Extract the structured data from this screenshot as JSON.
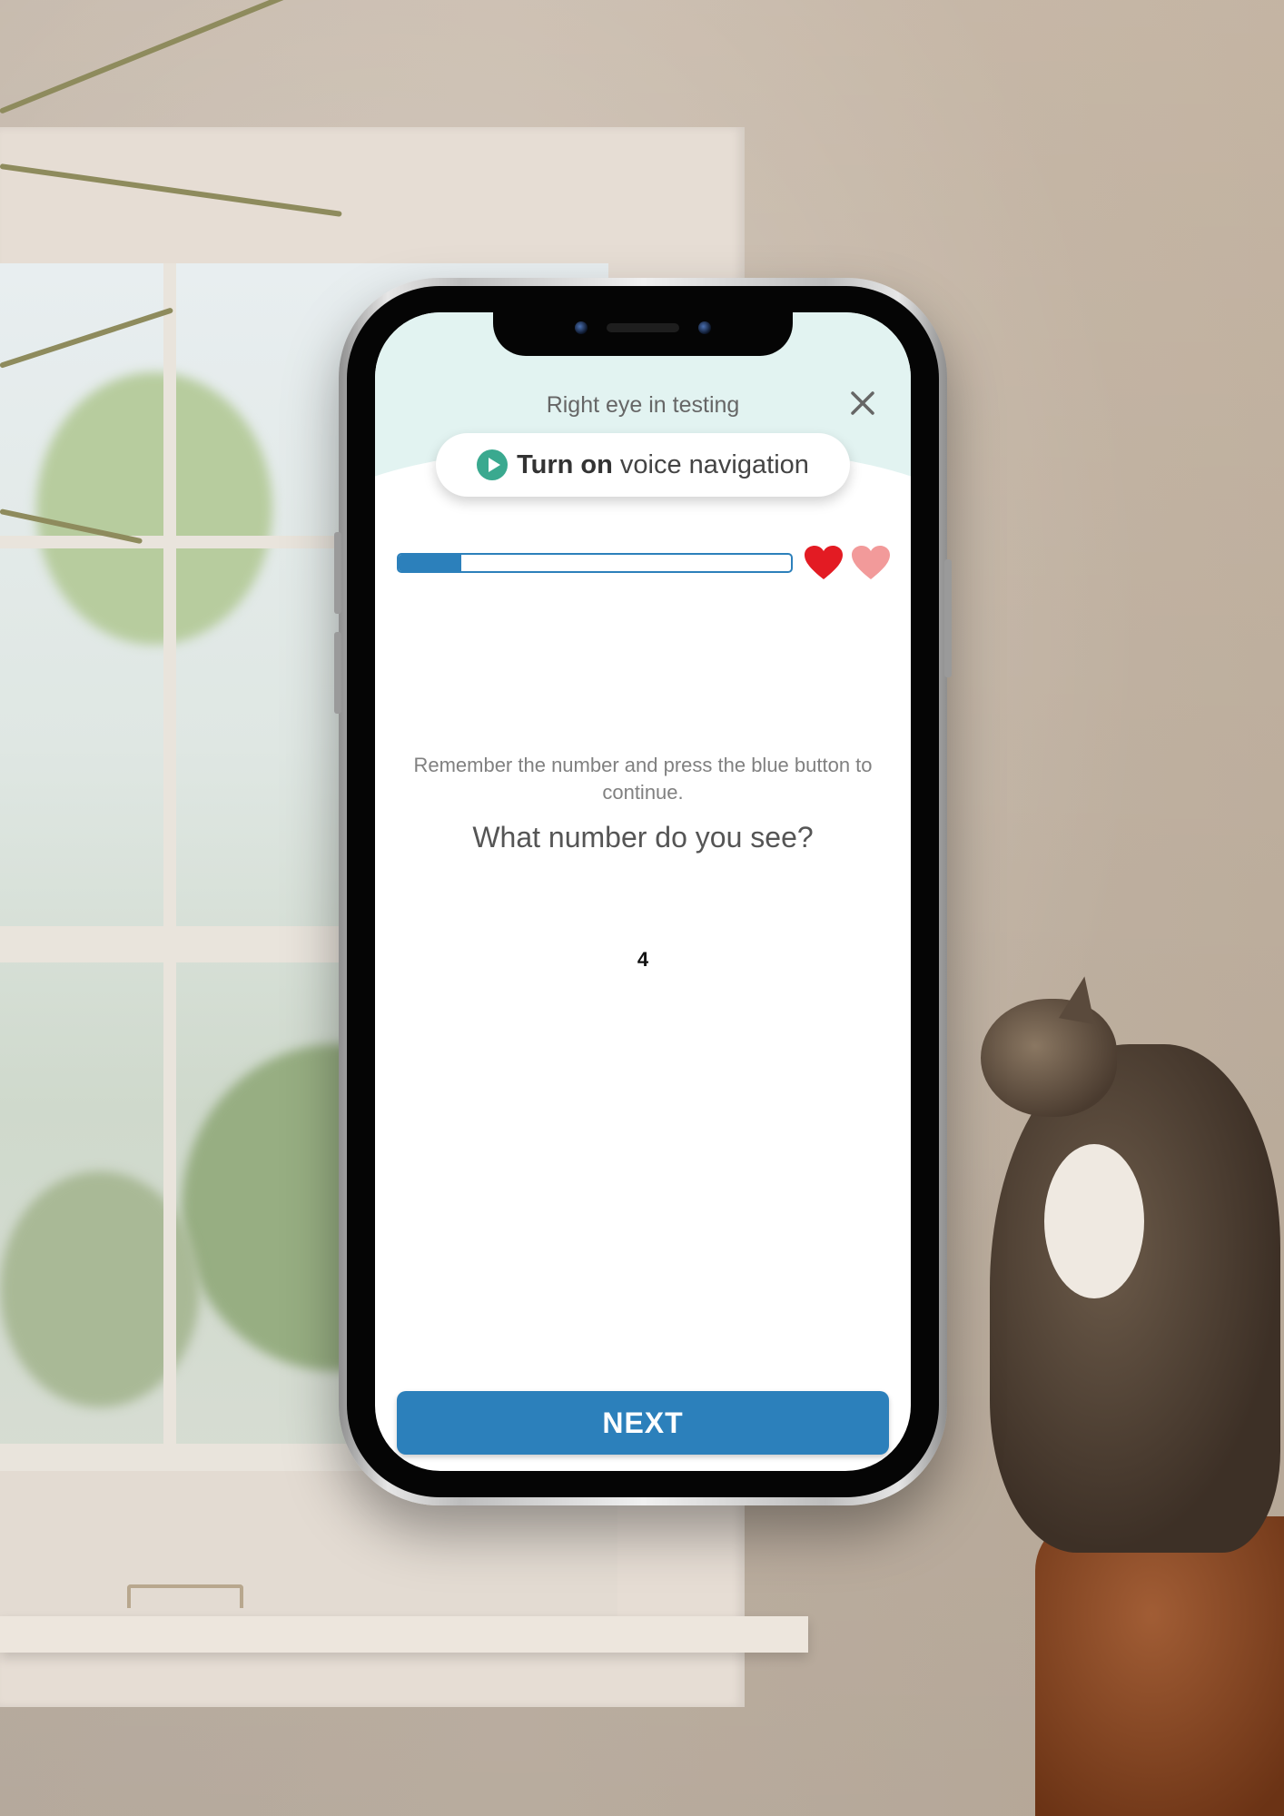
{
  "screen": {
    "header_title": "Right eye in testing",
    "close_icon": "close-icon",
    "voice_button": {
      "icon": "play-icon",
      "bold_label": "Turn on",
      "label": "voice navigation"
    },
    "progress": {
      "fraction": 0.16
    },
    "lives": {
      "total": 2,
      "full": 1,
      "full_color": "#e31b23",
      "empty_color": "#f29a9a"
    },
    "instruction": "Remember the number and press the blue button to continue.",
    "question": "What number do you see?",
    "shown_number": "4",
    "next_button_label": "NEXT"
  },
  "colors": {
    "accent": "#2c80bb",
    "header_band": "#e2f3f1",
    "play_icon": "#3aa98f"
  }
}
